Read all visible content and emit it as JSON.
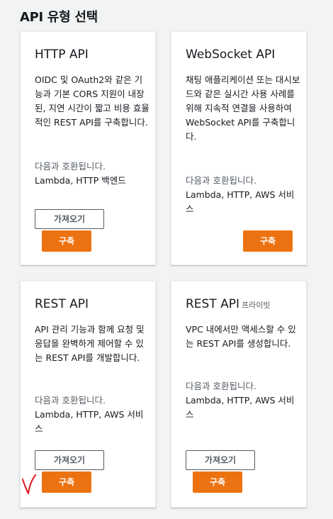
{
  "page": {
    "title": "API 유형 선택"
  },
  "cards": [
    {
      "title": "HTTP API",
      "title_suffix": "",
      "description": "OIDC 및 OAuth2와 같은 기능과 기본 CORS 지원이 내장된, 지연 시간이 짧고 비용 효율적인 REST API를 구축합니다.",
      "compat_label": "다음과 호환됩니다.",
      "compat_value": "Lambda, HTTP 백엔드",
      "import_label": "가져오기",
      "build_label": "구축"
    },
    {
      "title": "WebSocket API",
      "title_suffix": "",
      "description": "채팅 애플리케이션 또는 대시보드와 같은 실시간 사용 사례를 위해 지속적 연결을 사용하여 WebSocket API를 구축합니다.",
      "compat_label": "다음과 호환됩니다.",
      "compat_value": "Lambda, HTTP, AWS 서비스",
      "build_label": "구축"
    },
    {
      "title": "REST API",
      "title_suffix": "",
      "description": "API 관리 기능과 함께 요청 및 응답을 완벽하게 제어할 수 있는 REST API를 개발합니다.",
      "compat_label": "다음과 호환됩니다.",
      "compat_value": "Lambda, HTTP, AWS 서비스",
      "import_label": "가져오기",
      "build_label": "구축"
    },
    {
      "title": "REST API",
      "title_suffix": "프라이빗",
      "description": "VPC 내에서만 액세스할 수 있는 REST API를 생성합니다.",
      "compat_label": "다음과 호환됩니다.",
      "compat_value": "Lambda, HTTP, AWS 서비스",
      "import_label": "가져오기",
      "build_label": "구축"
    }
  ],
  "colors": {
    "accent": "#ec7211",
    "annotation": "#e0191f",
    "background": "#f2f3f3"
  },
  "annotation_icon": "check-mark-icon"
}
